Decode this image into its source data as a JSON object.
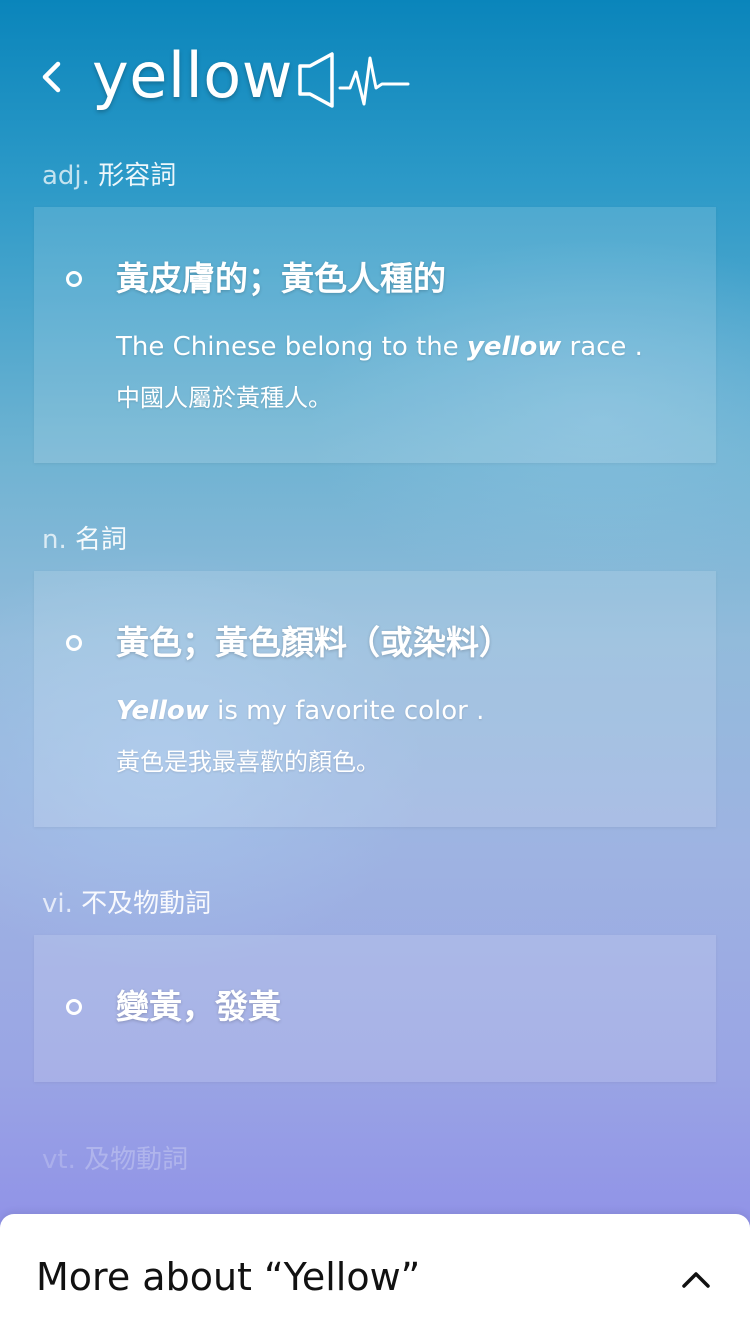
{
  "header": {
    "word": "yellow",
    "back_icon": "chevron-left-icon",
    "audio_icon": "speaker-waveform-icon"
  },
  "entries": [
    {
      "pos_abbr": "adj.",
      "pos_name": "形容詞",
      "sense": "黃皮膚的；黃色人種的",
      "example_en_before": "The Chinese belong to the ",
      "example_en_highlight": "yellow",
      "example_en_after": " race .",
      "example_zh": "中國人屬於黃種人。"
    },
    {
      "pos_abbr": "n.",
      "pos_name": "名詞",
      "sense": "黃色；黃色顏料（或染料）",
      "example_en_before": "",
      "example_en_highlight": "Yellow",
      "example_en_after": " is my favorite color .",
      "example_zh": "黃色是我最喜歡的顏色。"
    },
    {
      "pos_abbr": "vi.",
      "pos_name": "不及物動詞",
      "sense": "變黃，發黃"
    },
    {
      "pos_abbr": "vt.",
      "pos_name": "及物動詞"
    }
  ],
  "bottom_sheet": {
    "title": "More about “Yellow”",
    "expand_icon": "chevron-up-icon"
  },
  "colors": {
    "background_top": "#0a85bb",
    "background_bottom": "#8a86ea",
    "text": "#ffffff",
    "sheet_background": "#ffffff",
    "sheet_text": "#111111"
  }
}
